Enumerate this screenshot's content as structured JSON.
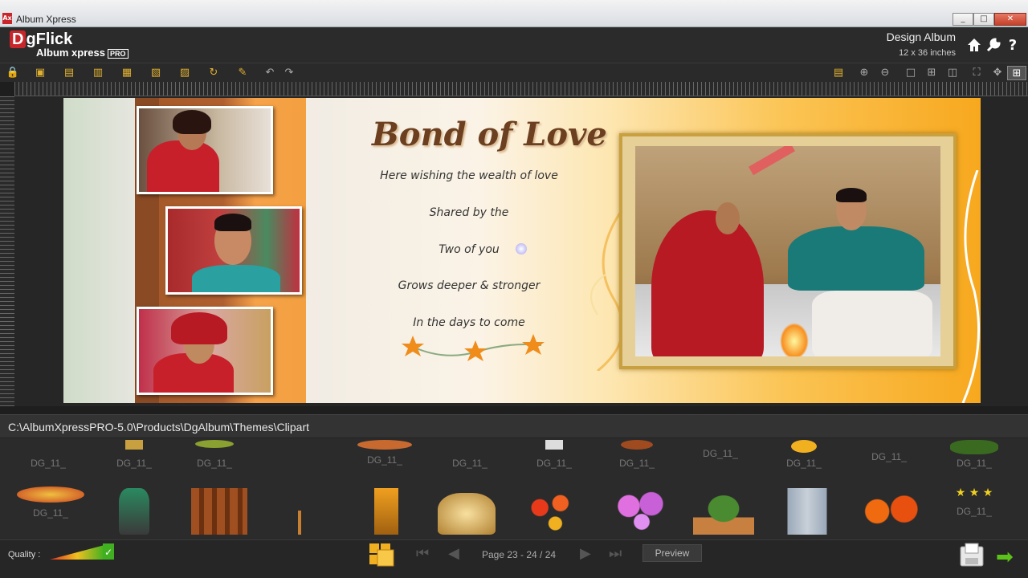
{
  "window": {
    "title": "Album Xpress",
    "app_icon_text": "Ax",
    "minimize": "_",
    "maximize": "□",
    "close": "✕"
  },
  "header": {
    "logo_mark": "D",
    "logo_text": "gFlick",
    "product": "Album xpress",
    "edition": "PRO",
    "mode_title": "Design Album",
    "album_size": "12 x 36 inches",
    "icons": [
      "home-icon",
      "wrench-icon",
      "help-icon"
    ],
    "help_glyph": "?"
  },
  "toolbar": {
    "left_icons": [
      "lock-icon",
      "bring-forward-icon",
      "send-backward-icon",
      "align-left-icon",
      "align-bottom-icon",
      "distribute-icon",
      "group-icon",
      "rotate-icon",
      "magic-wand-icon",
      "undo-icon",
      "redo-icon"
    ],
    "right_icons": [
      "align-icon",
      "zoom-in-icon",
      "zoom-out-icon",
      "layout-single-icon",
      "grid-icon",
      "layout-split-icon",
      "fit-icon",
      "pan-icon",
      "fullscreen-icon"
    ]
  },
  "spread": {
    "title": "Bond of Love",
    "lines": [
      "Here wishing the wealth of love",
      "Shared by the",
      "Two of you",
      "Grows deeper & stronger",
      "In the days to come"
    ]
  },
  "path": "C:\\AlbumXpressPRO-5.0\\Products\\DgAlbum\\Themes\\Clipart",
  "gallery": {
    "row1_labels": [
      "DG_11_",
      "DG_11_",
      "DG_11_",
      "",
      "DG_11_",
      "DG_11_",
      "DG_11_",
      "DG_11_",
      "DG_11_",
      "DG_11_",
      "DG_11_",
      "DG_11_"
    ],
    "row2_labels": [
      "DG_11_",
      "",
      "",
      "",
      "",
      "",
      "",
      "",
      "",
      "",
      "",
      "DG_11_"
    ]
  },
  "footer": {
    "quality_label": "Quality :",
    "page_label": "Page 23 - 24 / 24",
    "preview_label": "Preview",
    "first_glyph": "⏮",
    "prev_glyph": "◀",
    "next_glyph": "▶",
    "last_glyph": "⏭",
    "forward_glyph": "➡"
  },
  "colors": {
    "accent": "#c8262b",
    "next_arrow": "#5cc21a",
    "frame_gold": "#c9a040"
  }
}
